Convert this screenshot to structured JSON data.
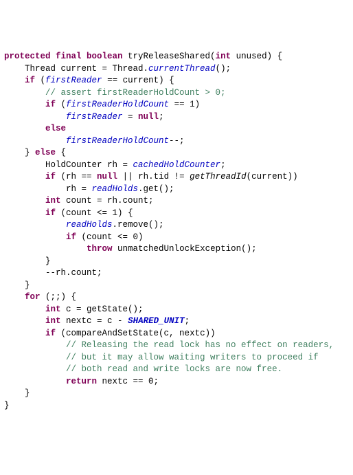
{
  "lines": [
    {
      "segs": [
        {
          "c": "kw",
          "t": "protected final boolean"
        },
        {
          "t": " tryReleaseShared("
        },
        {
          "c": "kw",
          "t": "int"
        },
        {
          "t": " unused) {"
        }
      ]
    },
    {
      "segs": [
        {
          "t": "    Thread current = Thread."
        },
        {
          "c": "st",
          "t": "currentThread"
        },
        {
          "t": "();"
        }
      ]
    },
    {
      "segs": [
        {
          "t": "    "
        },
        {
          "c": "kw",
          "t": "if"
        },
        {
          "t": " ("
        },
        {
          "c": "st",
          "t": "firstReader"
        },
        {
          "t": " == current) {"
        }
      ]
    },
    {
      "segs": [
        {
          "t": "        "
        },
        {
          "c": "cm",
          "t": "// assert firstReaderHoldCount > 0;"
        }
      ]
    },
    {
      "segs": [
        {
          "t": "        "
        },
        {
          "c": "kw",
          "t": "if"
        },
        {
          "t": " ("
        },
        {
          "c": "st",
          "t": "firstReaderHoldCount"
        },
        {
          "t": " == 1)"
        }
      ]
    },
    {
      "segs": [
        {
          "t": "            "
        },
        {
          "c": "st",
          "t": "firstReader"
        },
        {
          "t": " = "
        },
        {
          "c": "kw",
          "t": "null"
        },
        {
          "t": ";"
        }
      ]
    },
    {
      "segs": [
        {
          "t": "        "
        },
        {
          "c": "kw",
          "t": "else"
        }
      ]
    },
    {
      "segs": [
        {
          "t": "            "
        },
        {
          "c": "st",
          "t": "firstReaderHoldCount"
        },
        {
          "t": "--;"
        }
      ]
    },
    {
      "segs": [
        {
          "t": "    } "
        },
        {
          "c": "kw",
          "t": "else"
        },
        {
          "t": " {"
        }
      ]
    },
    {
      "segs": [
        {
          "t": "        HoldCounter rh = "
        },
        {
          "c": "st",
          "t": "cachedHoldCounter"
        },
        {
          "t": ";"
        }
      ]
    },
    {
      "segs": [
        {
          "t": "        "
        },
        {
          "c": "kw",
          "t": "if"
        },
        {
          "t": " (rh == "
        },
        {
          "c": "kw",
          "t": "null"
        },
        {
          "t": " || rh.tid != "
        },
        {
          "c": "fn",
          "t": "getThreadId"
        },
        {
          "t": "(current))"
        }
      ]
    },
    {
      "segs": [
        {
          "t": "            rh = "
        },
        {
          "c": "st",
          "t": "readHolds"
        },
        {
          "t": ".get();"
        }
      ]
    },
    {
      "segs": [
        {
          "t": "        "
        },
        {
          "c": "kw",
          "t": "int"
        },
        {
          "t": " count = rh.count;"
        }
      ]
    },
    {
      "segs": [
        {
          "t": "        "
        },
        {
          "c": "kw",
          "t": "if"
        },
        {
          "t": " (count <= 1) {"
        }
      ]
    },
    {
      "segs": [
        {
          "t": "            "
        },
        {
          "c": "st",
          "t": "readHolds"
        },
        {
          "t": ".remove();"
        }
      ]
    },
    {
      "segs": [
        {
          "t": "            "
        },
        {
          "c": "kw",
          "t": "if"
        },
        {
          "t": " (count <= 0)"
        }
      ]
    },
    {
      "segs": [
        {
          "t": "                "
        },
        {
          "c": "kw",
          "t": "throw"
        },
        {
          "t": " unmatchedUnlockException();"
        }
      ]
    },
    {
      "segs": [
        {
          "t": "        }"
        }
      ]
    },
    {
      "segs": [
        {
          "t": "        --rh.count;"
        }
      ]
    },
    {
      "segs": [
        {
          "t": "    }"
        }
      ]
    },
    {
      "segs": [
        {
          "t": "    "
        },
        {
          "c": "kw",
          "t": "for"
        },
        {
          "t": " (;;) {"
        }
      ]
    },
    {
      "segs": [
        {
          "t": "        "
        },
        {
          "c": "kw",
          "t": "int"
        },
        {
          "t": " c = getState();"
        }
      ]
    },
    {
      "segs": [
        {
          "t": "        "
        },
        {
          "c": "kw",
          "t": "int"
        },
        {
          "t": " nextc = c - "
        },
        {
          "c": "cn",
          "t": "SHARED_UNIT"
        },
        {
          "t": ";"
        }
      ]
    },
    {
      "segs": [
        {
          "t": "        "
        },
        {
          "c": "kw",
          "t": "if"
        },
        {
          "t": " (compareAndSetState(c, nextc))"
        }
      ]
    },
    {
      "segs": [
        {
          "t": "            "
        },
        {
          "c": "cm",
          "t": "// Releasing the read lock has no effect on readers,"
        }
      ]
    },
    {
      "segs": [
        {
          "t": "            "
        },
        {
          "c": "cm",
          "t": "// but it may allow waiting writers to proceed if"
        }
      ]
    },
    {
      "segs": [
        {
          "t": "            "
        },
        {
          "c": "cm",
          "t": "// both read and write locks are now free."
        }
      ]
    },
    {
      "segs": [
        {
          "t": "            "
        },
        {
          "c": "kw",
          "t": "return"
        },
        {
          "t": " nextc == 0;"
        }
      ]
    },
    {
      "segs": [
        {
          "t": "    }"
        }
      ]
    },
    {
      "segs": [
        {
          "t": "}"
        }
      ]
    }
  ]
}
